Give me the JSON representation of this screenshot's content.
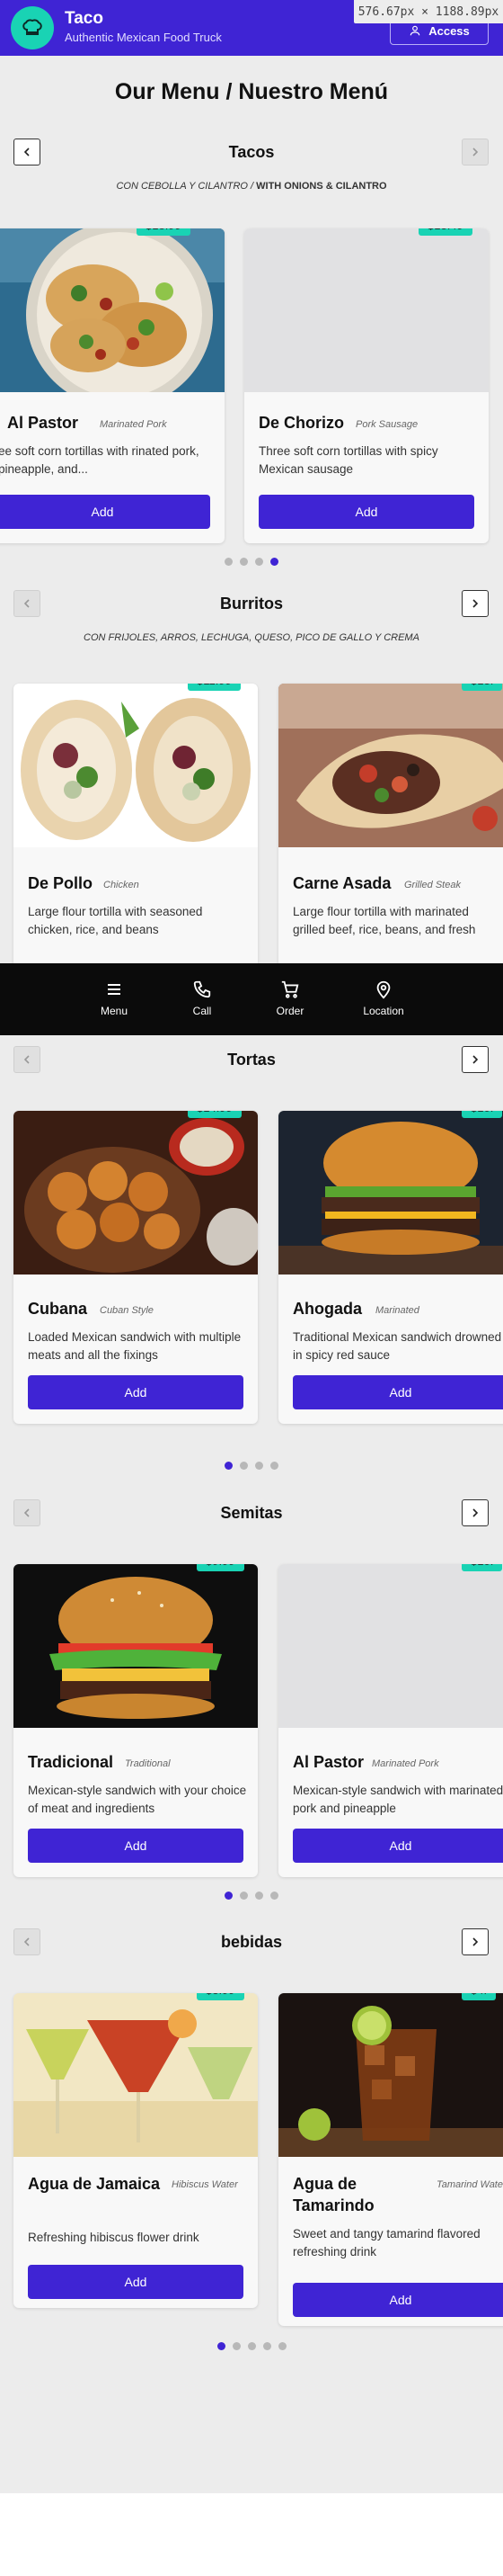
{
  "header": {
    "brand_name": "Taco",
    "brand_subtitle": "Authentic Mexican Food Truck",
    "access_label": "Access",
    "dimension_readout": "576.67px × 1188.89px"
  },
  "page_title": "Our Menu / Nuestro Menú",
  "sections": {
    "tacos": {
      "title": "Tacos",
      "subtitle_es": "CON CEBOLLA Y CILANTRO /",
      "subtitle_en": "WITH ONIONS & CILANTRO",
      "items": [
        {
          "name": "Al Pastor",
          "tag": "Marinated Pork",
          "desc": "ee soft corn tortillas with rinated pork, pineapple, and...",
          "price": "$13.99",
          "button": "Add"
        },
        {
          "name": "De Chorizo",
          "tag": "Pork Sausage",
          "desc": "Three soft corn tortillas with spicy Mexican sausage",
          "price": "$13.49",
          "button": "Add"
        }
      ]
    },
    "burritos": {
      "title": "Burritos",
      "subtitle": "CON FRIJOLES, ARROS, LECHUGA, QUESO, PICO DE GALLO Y CREMA",
      "items": [
        {
          "name": "De Pollo",
          "tag": "Chicken",
          "desc": "Large flour tortilla with seasoned chicken, rice, and beans",
          "price": "$11.99",
          "button": "Add"
        },
        {
          "name": "Carne Asada",
          "tag": "Grilled Steak",
          "desc": "Large flour tortilla with marinated grilled beef, rice, beans, and fresh",
          "price": "$13.",
          "button": "Add"
        }
      ]
    },
    "tortas": {
      "title": "Tortas",
      "items": [
        {
          "name": "Cubana",
          "tag": "Cuban Style",
          "desc": "Loaded Mexican sandwich with multiple meats and all the fixings",
          "price": "$14.99",
          "button": "Add"
        },
        {
          "name": "Ahogada",
          "tag": "Marinated",
          "desc": "Traditional Mexican sandwich drowned in spicy red sauce",
          "price": "$10.",
          "button": "Add"
        }
      ]
    },
    "semitas": {
      "title": "Semitas",
      "items": [
        {
          "name": "Tradicional",
          "tag": "Traditional",
          "desc": "Mexican-style sandwich with your choice of meat and ingredients",
          "price": "$9.99",
          "button": "Add"
        },
        {
          "name": "Al Pastor",
          "tag": "Marinated Pork",
          "desc": "Mexican-style sandwich with marinated pork and pineapple",
          "price": "$10.",
          "button": "Add"
        }
      ]
    },
    "bebidas": {
      "title": "bebidas",
      "items": [
        {
          "name": "Agua de Jamaica",
          "tag": "Hibiscus Water",
          "desc": "Refreshing hibiscus flower drink",
          "price": "$3.99",
          "button": "Add"
        },
        {
          "name": "Agua de Tamarindo",
          "tag": "Tamarind Water",
          "desc": "Sweet and tangy tamarind flavored refreshing drink",
          "price": "$4.",
          "button": "Add"
        }
      ]
    }
  },
  "bottom_nav": {
    "menu": "Menu",
    "call": "Call",
    "order": "Order",
    "location": "Location"
  },
  "carousel_pages": {
    "tacos": {
      "count": 4,
      "active": 4
    },
    "tortas": {
      "count": 4,
      "active": 1
    },
    "semitas": {
      "count": 4,
      "active": 1
    },
    "bebidas": {
      "count": 5,
      "active": 1
    }
  },
  "colors": {
    "brand": "#3f24d4",
    "accent": "#19d3b4",
    "nav_background": "#0b0b0b",
    "page_background": "#ececec"
  }
}
